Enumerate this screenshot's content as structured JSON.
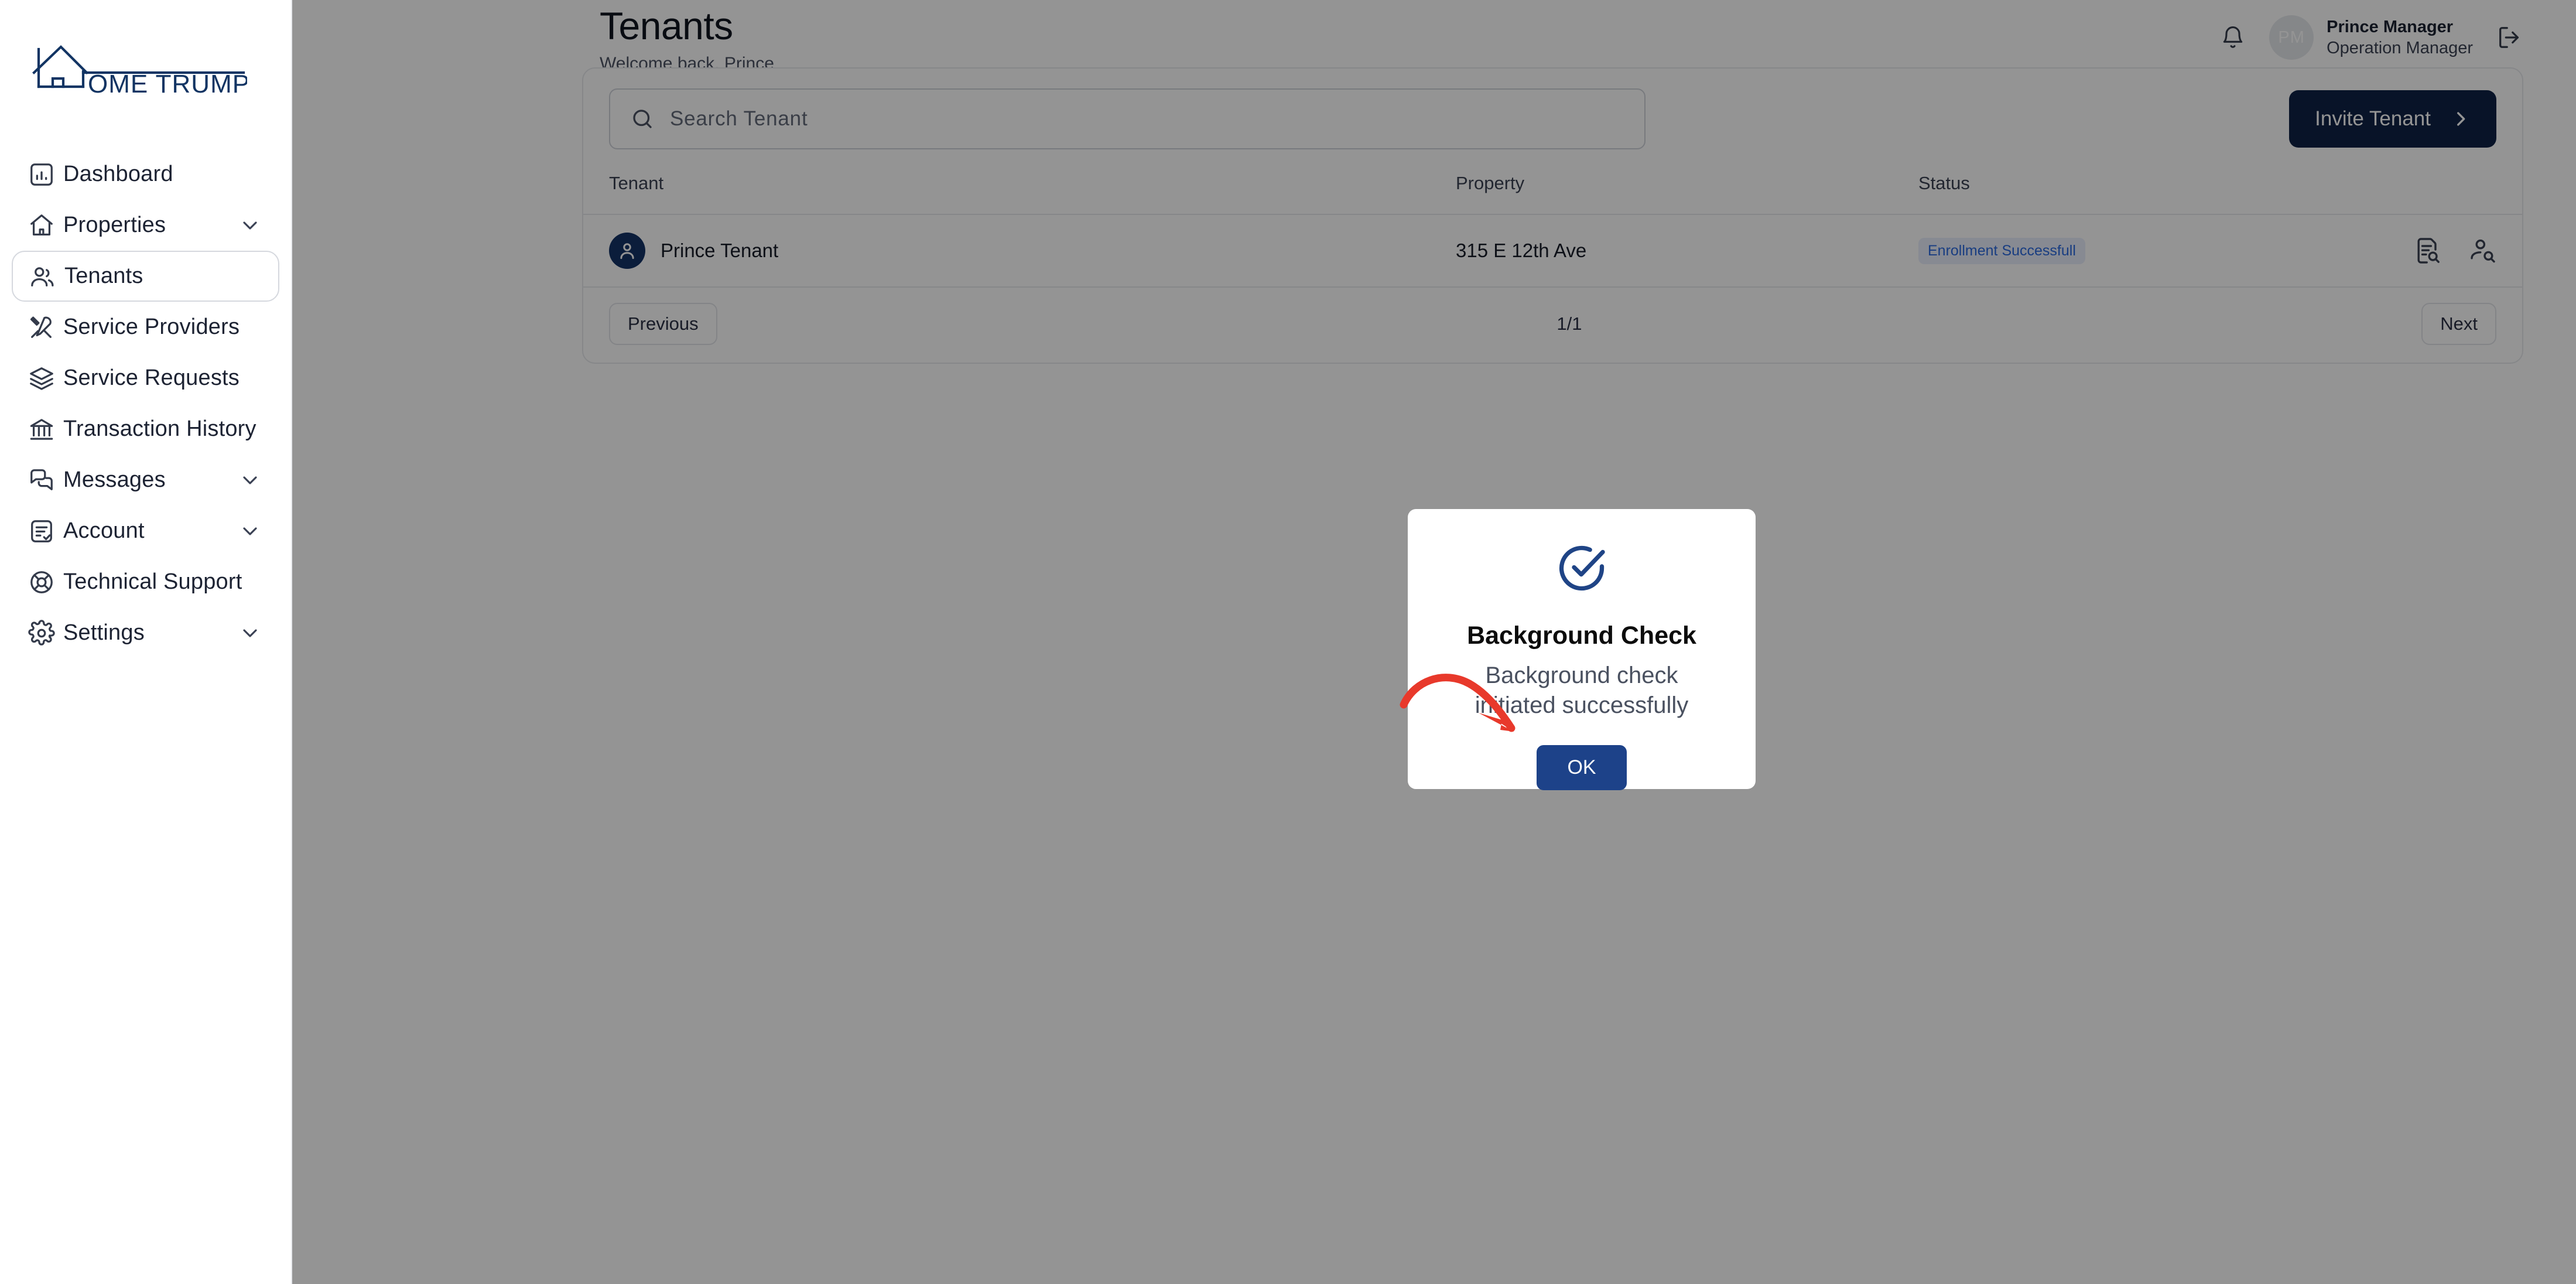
{
  "brand": {
    "logo_text": "OME TRUMPETER",
    "logo_full_name": "HOME TRUMPETER",
    "logo_color": "#123463"
  },
  "sidebar": {
    "items": [
      {
        "label": "Dashboard",
        "icon": "chart-bar-icon",
        "active": false,
        "expandable": false
      },
      {
        "label": "Properties",
        "icon": "home-icon",
        "active": false,
        "expandable": true
      },
      {
        "label": "Tenants",
        "icon": "users-icon",
        "active": true,
        "expandable": false
      },
      {
        "label": "Service Providers",
        "icon": "tools-icon",
        "active": false,
        "expandable": false
      },
      {
        "label": "Service Requests",
        "icon": "layers-icon",
        "active": false,
        "expandable": false
      },
      {
        "label": "Transaction History",
        "icon": "bank-icon",
        "active": false,
        "expandable": false
      },
      {
        "label": "Messages",
        "icon": "chat-icon",
        "active": false,
        "expandable": true
      },
      {
        "label": "Account",
        "icon": "clipboard-check-icon",
        "active": false,
        "expandable": true
      },
      {
        "label": "Technical Support",
        "icon": "lifebuoy-icon",
        "active": false,
        "expandable": false
      },
      {
        "label": "Settings",
        "icon": "gear-icon",
        "active": false,
        "expandable": true
      }
    ]
  },
  "header": {
    "title": "Tenants",
    "subtitle": "Welcome back, Prince",
    "notification_icon": "bell-icon",
    "logout_icon": "logout-icon",
    "user": {
      "initials": "PM",
      "name": "Prince Manager",
      "role": "Operation Manager"
    }
  },
  "toolbar": {
    "search_placeholder": "Search Tenant",
    "search_value": "",
    "search_icon": "search-icon",
    "invite_label": "Invite Tenant",
    "invite_icon": "chevron-right-icon",
    "invite_bg": "#0e2146"
  },
  "table": {
    "columns": [
      "Tenant",
      "Property",
      "Status",
      ""
    ],
    "rows": [
      {
        "tenant": "Prince Tenant",
        "property": "315 E 12th Ave",
        "status": "Enrollment Successfull",
        "status_color": "#2b6adf",
        "status_bg": "#e8eefc",
        "actions": [
          "document-search-icon",
          "person-search-icon"
        ]
      }
    ]
  },
  "pagination": {
    "previous_label": "Previous",
    "page_indicator": "1/1",
    "next_label": "Next"
  },
  "modal": {
    "icon": "check-circle-icon",
    "icon_color": "#1f4486",
    "title": "Background Check",
    "message": "Background check initiated successfully",
    "ok_label": "OK",
    "ok_bg": "#1d4289"
  },
  "annotation": {
    "type": "curved-arrow",
    "color": "#e8392b",
    "points_to": "OK"
  }
}
